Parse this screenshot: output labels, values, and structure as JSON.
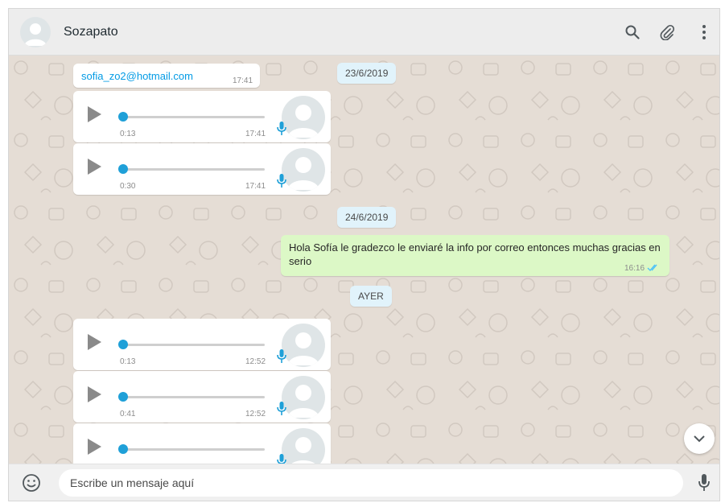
{
  "header": {
    "contact_name": "Sozapato",
    "icons": [
      "search-icon",
      "attach-icon",
      "menu-icon"
    ]
  },
  "dates": {
    "first": "23/6/2019",
    "second": "24/6/2019",
    "third": "AYER"
  },
  "messages": {
    "email": {
      "text": "sofia_zo2@hotmail.com",
      "time": "17:41"
    },
    "outgoing": {
      "text": "Hola Sofía le gradezco le enviaré la info por correo entonces muchas gracias en serio",
      "time": "16:16",
      "status": "read"
    }
  },
  "audios": [
    {
      "duration": "0:13",
      "time": "17:41"
    },
    {
      "duration": "0:30",
      "time": "17:41"
    },
    {
      "duration": "0:13",
      "time": "12:52"
    },
    {
      "duration": "0:41",
      "time": "12:52"
    },
    {
      "duration": "",
      "time": ""
    }
  ],
  "footer": {
    "placeholder": "Escribe un mensaje aquí",
    "icons": [
      "emoji-icon",
      "mic-icon"
    ]
  },
  "colors": {
    "header_bg": "#ededed",
    "chat_bg": "#e5ddd5",
    "outgoing_bubble": "#dcf8c6",
    "date_pill": "#e1f3fb",
    "accent_blue": "#1fa0d8",
    "read_ticks": "#4fc3f7"
  }
}
